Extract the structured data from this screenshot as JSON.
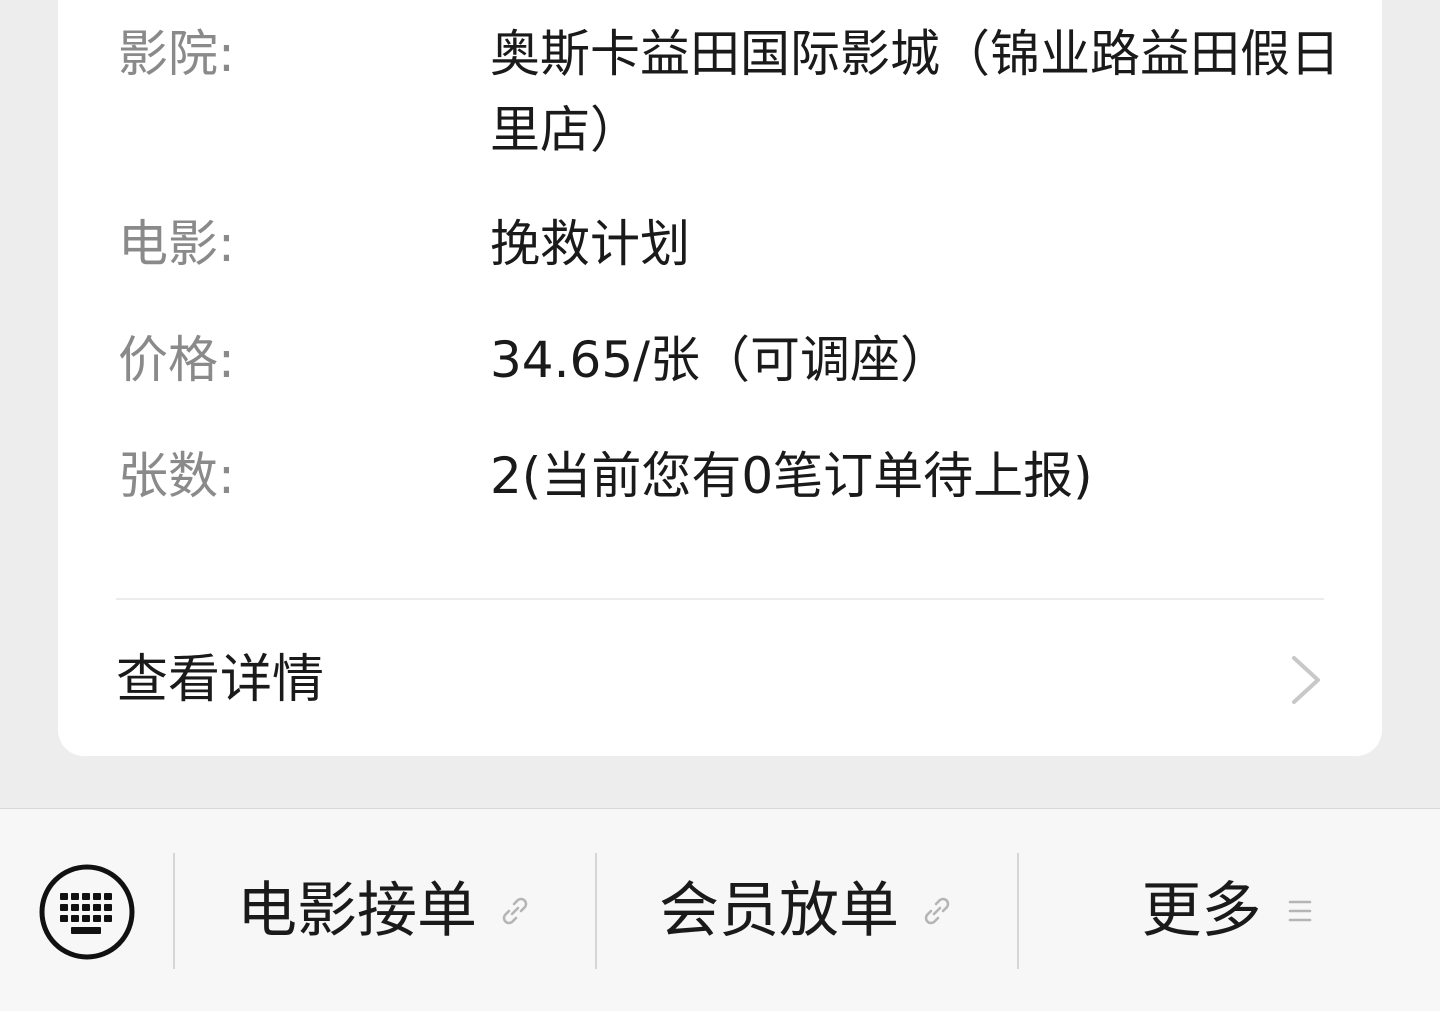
{
  "details": [
    {
      "label": "影院:",
      "value": "奥斯卡益田国际影城（锦业路益田假日里店）"
    },
    {
      "label": "电影:",
      "value": "挽救计划"
    },
    {
      "label": "价格:",
      "value": "34.65/张（可调座）"
    },
    {
      "label": "张数:",
      "value": "2(当前您有0笔订单待上报)"
    }
  ],
  "view_details_label": "查看详情",
  "bottom_menu": [
    {
      "label": "电影接单",
      "icon": "link-icon"
    },
    {
      "label": "会员放单",
      "icon": "link-icon"
    },
    {
      "label": "更多",
      "icon": "menu-lines-icon"
    }
  ],
  "keyboard_icon": "keyboard-icon"
}
